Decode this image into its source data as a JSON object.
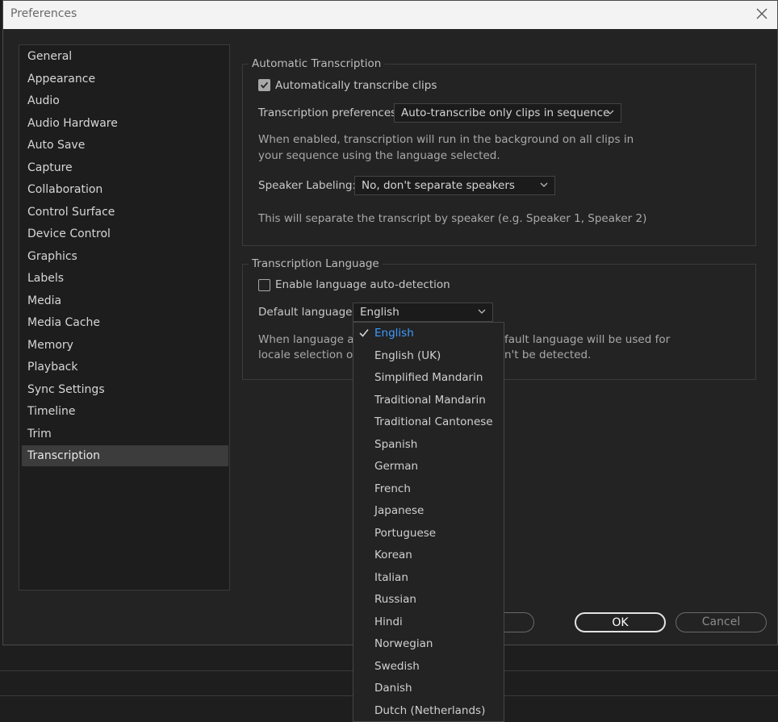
{
  "window": {
    "title": "Preferences"
  },
  "sidebar": {
    "items": [
      {
        "label": "General"
      },
      {
        "label": "Appearance"
      },
      {
        "label": "Audio"
      },
      {
        "label": "Audio Hardware"
      },
      {
        "label": "Auto Save"
      },
      {
        "label": "Capture"
      },
      {
        "label": "Collaboration"
      },
      {
        "label": "Control Surface"
      },
      {
        "label": "Device Control"
      },
      {
        "label": "Graphics"
      },
      {
        "label": "Labels"
      },
      {
        "label": "Media"
      },
      {
        "label": "Media Cache"
      },
      {
        "label": "Memory"
      },
      {
        "label": "Playback"
      },
      {
        "label": "Sync Settings"
      },
      {
        "label": "Timeline"
      },
      {
        "label": "Trim"
      },
      {
        "label": "Transcription"
      }
    ],
    "selected": "Transcription"
  },
  "auto_transcription": {
    "group_label": "Automatic Transcription",
    "auto_checkbox_label": "Automatically transcribe clips",
    "auto_checked": true,
    "prefs_label": "Transcription preferences:",
    "prefs_value": "Auto-transcribe only clips in sequence",
    "prefs_desc": "When enabled, transcription will run in the background on all clips in your sequence using the language selected.",
    "speaker_label": "Speaker Labeling:",
    "speaker_value": "No, don't separate speakers",
    "speaker_desc": "This will separate the transcript by speaker (e.g. Speaker 1, Speaker 2)"
  },
  "language": {
    "group_label": "Transcription Language",
    "autodetect_label": "Enable language auto-detection",
    "autodetect_checked": false,
    "default_label": "Default language:",
    "default_value": "English",
    "desc_line1_left": "When language aut",
    "desc_line1_right": "fault language will be used for",
    "desc_line2_left": "locale selection or",
    "desc_line2_right": "n't be detected."
  },
  "dropdown": {
    "options": [
      {
        "label": "English"
      },
      {
        "label": "English (UK)"
      },
      {
        "label": "Simplified Mandarin"
      },
      {
        "label": "Traditional Mandarin"
      },
      {
        "label": "Traditional Cantonese"
      },
      {
        "label": "Spanish"
      },
      {
        "label": "German"
      },
      {
        "label": "French"
      },
      {
        "label": "Japanese"
      },
      {
        "label": "Portuguese"
      },
      {
        "label": "Korean"
      },
      {
        "label": "Italian"
      },
      {
        "label": "Russian"
      },
      {
        "label": "Hindi"
      },
      {
        "label": "Norwegian"
      },
      {
        "label": "Swedish"
      },
      {
        "label": "Danish"
      },
      {
        "label": "Dutch (Netherlands)"
      }
    ],
    "selected": "English",
    "selected_color": "#3d9bff"
  },
  "buttons": {
    "ok": "OK",
    "cancel": "Cancel"
  }
}
